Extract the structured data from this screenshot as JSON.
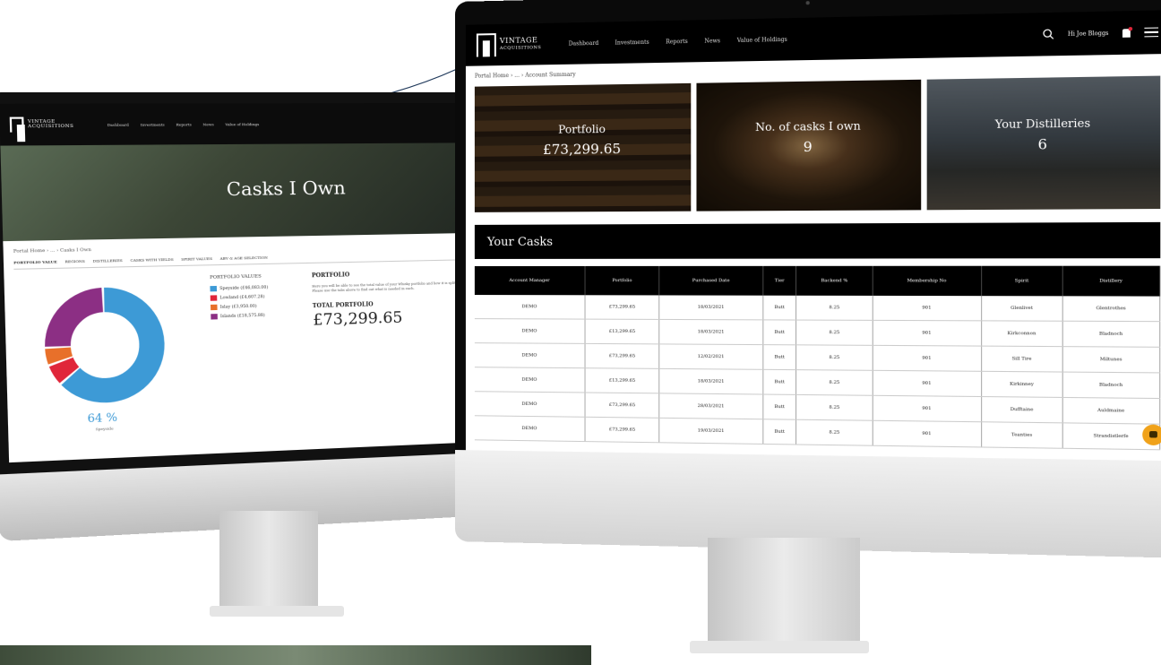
{
  "back_screen": {
    "logo": {
      "line1": "VINTAGE",
      "line2": "ACQUISITIONS"
    },
    "nav": [
      "Dashboard",
      "Investments",
      "Reports",
      "News",
      "Value of Holdings"
    ],
    "hero_title": "Casks I Own",
    "breadcrumb": "Portal Home  ›  ...  ›  Casks I Own",
    "tabs": [
      "PORTFOLIO VALUE",
      "REGIONS",
      "DISTILLERIES",
      "CASKS WITH YIELDS",
      "SPIRIT VALUES",
      "ABV & AGE SELECTION"
    ],
    "legend_title": "PORTFOLIO VALUES",
    "legend": [
      {
        "label": "Speyside (£46,083.00)",
        "color": "#3d9ad6"
      },
      {
        "label": "Lowland (£4,607.28)",
        "color": "#e0263a"
      },
      {
        "label": "Islay (£3,950.00)",
        "color": "#e8702a"
      },
      {
        "label": "Islands (£18,575.88)",
        "color": "#8c2f84"
      }
    ],
    "portfolio_heading": "PORTFOLIO",
    "portfolio_text": "Here you will be able to see the total value of your Whisky portfolio and how it is split across collections. Please use the tabs above to find out what is needed in each.",
    "total_label": "TOTAL PORTFOLIO",
    "total_value": "£73,299.65",
    "donut_percent": "64 %",
    "donut_caption": "Speyside",
    "donut_values": [
      64,
      6,
      5,
      25
    ]
  },
  "front_screen": {
    "logo": {
      "line1": "VINTAGE",
      "line2": "ACQUISITIONS"
    },
    "nav": [
      "Dashboard",
      "Investments",
      "Reports",
      "News",
      "Value of Holdings"
    ],
    "user_label": "Hi Joe Bloggs",
    "breadcrumb": "Portal Home  ›  ...  ›  Account Summary",
    "cards": [
      {
        "title": "Portfolio",
        "value": "£73,299.65"
      },
      {
        "title": "No. of casks I own",
        "value": "9"
      },
      {
        "title": "Your Distilleries",
        "value": "6"
      }
    ],
    "section_title": "Your Casks",
    "table": {
      "headers": [
        "Account Manager",
        "Portfolio",
        "Purchased Date",
        "Tier",
        "Backend %",
        "Membership No",
        "Spirit",
        "Distillery"
      ],
      "rows": [
        [
          "DEMO",
          "£73,299.65",
          "18/03/2021",
          "Butt",
          "8.25",
          "901",
          "Glenlivet",
          "Glentrothes"
        ],
        [
          "DEMO",
          "£13,299.65",
          "18/03/2021",
          "Butt",
          "8.25",
          "901",
          "Kirkconnon",
          "Bladnoch"
        ],
        [
          "DEMO",
          "£73,299.65",
          "12/02/2021",
          "Butt",
          "8.25",
          "901",
          "Sill Tire",
          "Miltunes"
        ],
        [
          "DEMO",
          "£13,299.65",
          "18/03/2021",
          "Butt",
          "8.25",
          "901",
          "Kirkinney",
          "Bladnoch"
        ],
        [
          "DEMO",
          "£73,299.65",
          "28/03/2021",
          "Butt",
          "8.25",
          "901",
          "Dufftaine",
          "Auldmaine"
        ],
        [
          "DEMO",
          "£73,299.65",
          "19/03/2021",
          "Butt",
          "8.25",
          "901",
          "Teanties",
          "Strandistlerfe"
        ]
      ]
    }
  }
}
